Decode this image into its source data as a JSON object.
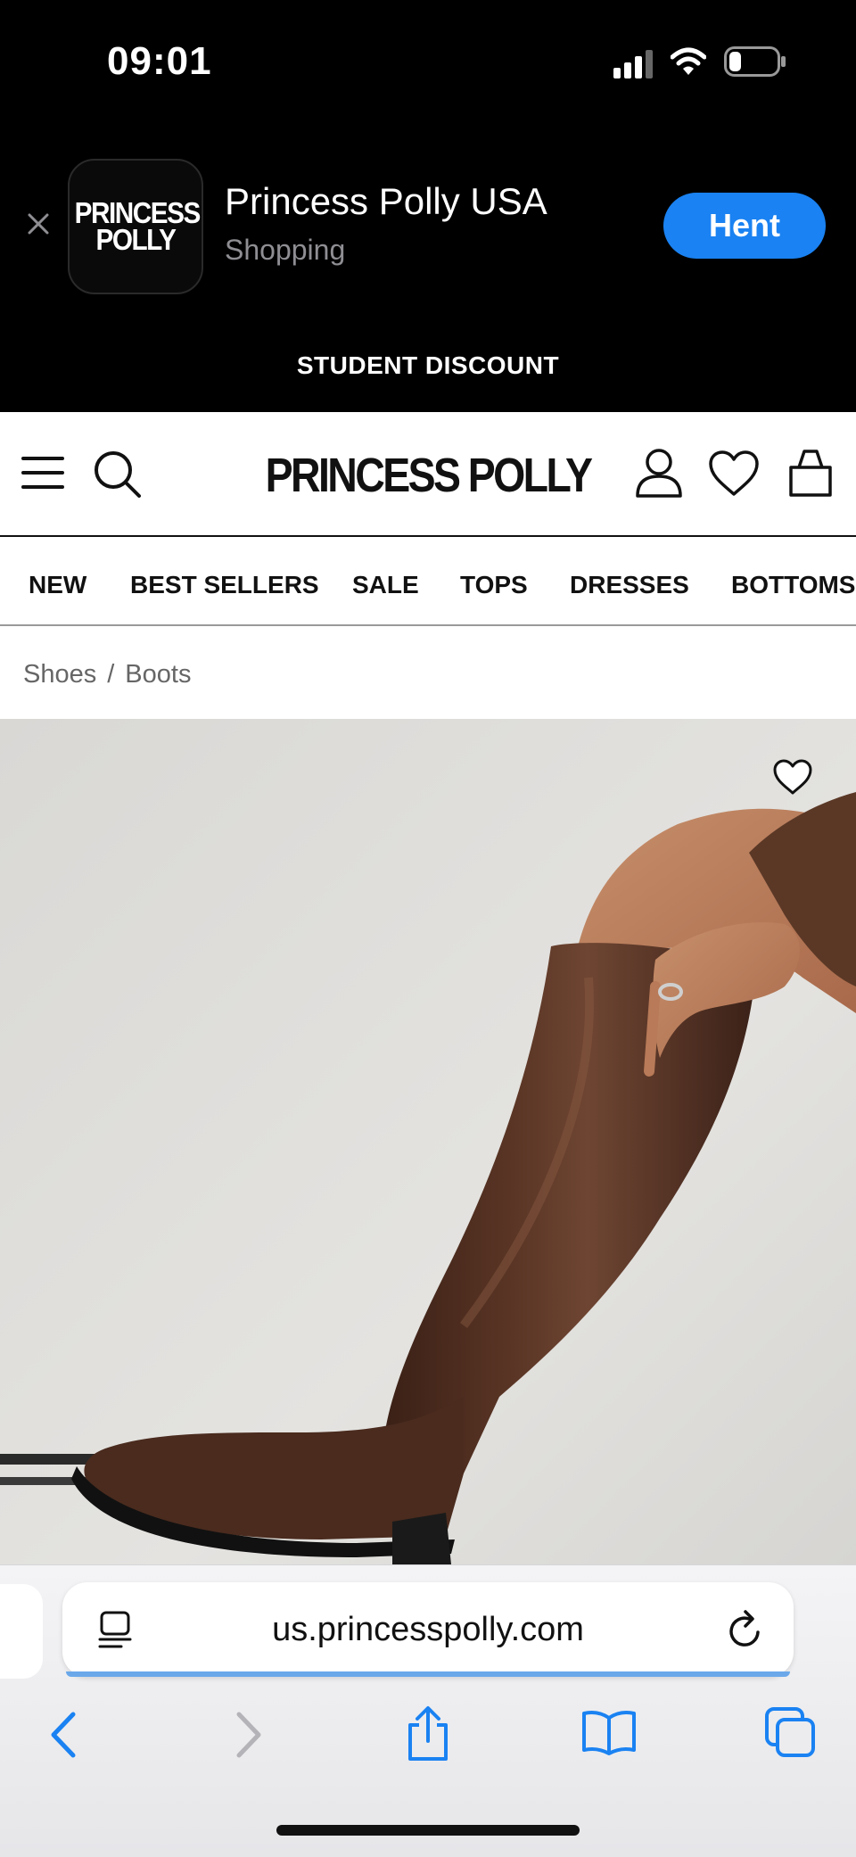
{
  "status_bar": {
    "time": "09:01",
    "battery_level": 0.25
  },
  "app_banner": {
    "icon_text": "PRINCESS POLLY",
    "app_name": "Princess Polly USA",
    "category": "Shopping",
    "get_button": "Hent"
  },
  "promo_bar": {
    "text": "STUDENT DISCOUNT"
  },
  "header": {
    "logo": "PRINCESS POLLY"
  },
  "nav": {
    "items": [
      "NEW",
      "BEST SELLERS",
      "SALE",
      "TOPS",
      "DRESSES",
      "BOTTOMS"
    ]
  },
  "breadcrumb": {
    "items": [
      "Shoes",
      "Boots"
    ],
    "separator": "/"
  },
  "browser": {
    "url": "us.princesspolly.com"
  },
  "colors": {
    "accent": "#1a82f2",
    "boot": "#4a2b1e",
    "background": "#e6e5e2"
  },
  "icons": [
    "menu-icon",
    "search-icon",
    "account-icon",
    "heart-icon",
    "bag-icon",
    "reader-icon",
    "reload-icon",
    "back-icon",
    "forward-icon",
    "share-icon",
    "bookmarks-icon",
    "tabs-icon"
  ]
}
